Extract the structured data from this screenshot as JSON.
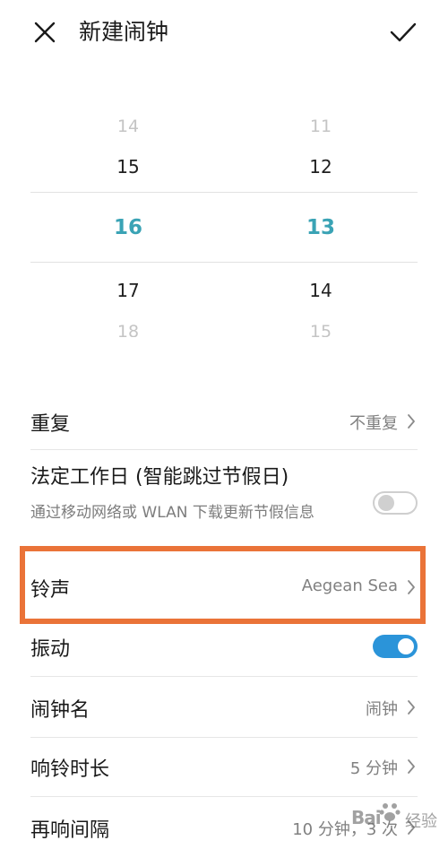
{
  "header": {
    "title": "新建闹钟",
    "close_icon": "close-icon",
    "confirm_icon": "check-icon"
  },
  "picker": {
    "hours": {
      "far_prev": "14",
      "prev": "15",
      "selected": "16",
      "next": "17",
      "far_next": "18"
    },
    "minutes": {
      "far_prev": "11",
      "prev": "12",
      "selected": "13",
      "next": "14",
      "far_next": "15"
    }
  },
  "settings": {
    "repeat": {
      "label": "重复",
      "value": "不重复"
    },
    "workday": {
      "label": "法定工作日 (智能跳过节假日)",
      "subtitle": "通过移动网络或 WLAN 下载更新节假信息",
      "enabled": false
    },
    "ringtone": {
      "label": "铃声",
      "value": "Aegean Sea"
    },
    "vibrate": {
      "label": "振动",
      "enabled": true
    },
    "alarm_name": {
      "label": "闹钟名",
      "value": "闹钟"
    },
    "ring_duration": {
      "label": "响铃时长",
      "value": "5 分钟"
    },
    "snooze_interval": {
      "label": "再响间隔",
      "value": "10 分钟，3 次"
    }
  },
  "colors": {
    "accent": "#3aa3b5",
    "toggle_on": "#2b94d9",
    "highlight": "#ea7338"
  },
  "watermark": {
    "text": "Bai",
    "suffix": "经验"
  }
}
